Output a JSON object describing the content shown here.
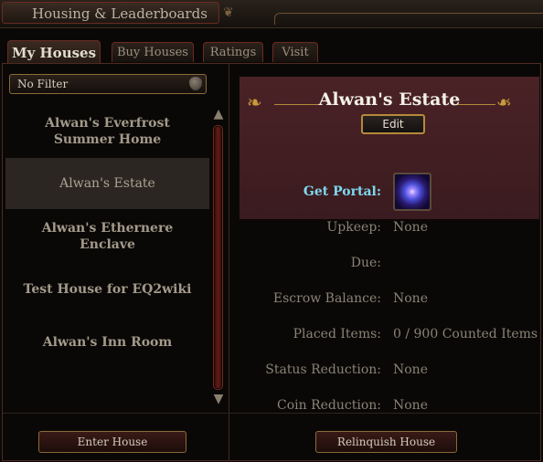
{
  "window": {
    "title": "Housing & Leaderboards"
  },
  "tabs": [
    {
      "label": "My Houses",
      "active": true
    },
    {
      "label": "Buy Houses",
      "active": false
    },
    {
      "label": "Ratings",
      "active": false
    },
    {
      "label": "Visit",
      "active": false
    }
  ],
  "filter": {
    "selected": "No Filter"
  },
  "houses": [
    {
      "name": "Alwan's Everfrost Summer Home",
      "selected": false
    },
    {
      "name": "Alwan's Estate",
      "selected": true
    },
    {
      "name": "Alwan's Ethernere Enclave",
      "selected": false
    },
    {
      "name": "Test House for EQ2wiki",
      "selected": false
    },
    {
      "name": "Alwan's Inn Room",
      "selected": false
    }
  ],
  "buttons": {
    "enter_house": "Enter House",
    "relinquish_house": "Relinquish House",
    "edit": "Edit"
  },
  "details": {
    "house_name": "Alwan's Estate",
    "get_portal_label": "Get Portal:",
    "rows": [
      {
        "label": "Upkeep:",
        "value": "None"
      },
      {
        "label": "Due:",
        "value": ""
      },
      {
        "label": "Escrow Balance:",
        "value": "None"
      },
      {
        "label": "Placed Items:",
        "value": "0 / 900 Counted Items"
      },
      {
        "label": "Status Reduction:",
        "value": "None"
      },
      {
        "label": "Coin Reduction:",
        "value": "None"
      }
    ]
  },
  "icons": {
    "portal": "portal-icon",
    "filter_dropdown": "chevron-down-icon",
    "scroll_up": "arrow-up-icon",
    "scroll_down": "arrow-down-icon"
  },
  "colors": {
    "accent_gold": "#b58a3a",
    "portal_label": "#7fd9f0",
    "estate_panel": "#4a2226"
  }
}
